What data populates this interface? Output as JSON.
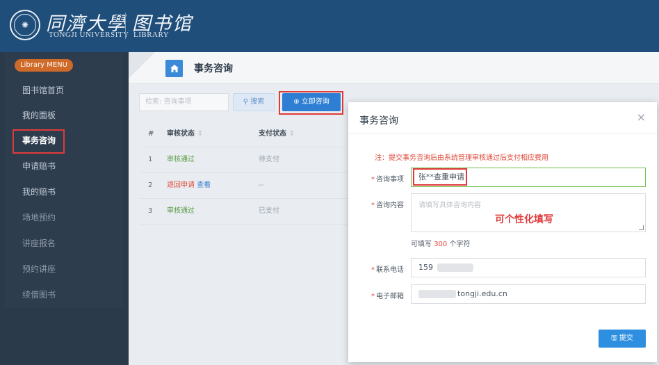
{
  "header": {
    "logo_cn": "同濟大學",
    "logo_en": "TONGJI UNIVERSITY",
    "library_cn": "图书馆",
    "library_en": "LIBRARY"
  },
  "sidebar": {
    "menu_badge": "Library MENU",
    "items": [
      {
        "label": "图书馆首页"
      },
      {
        "label": "我的面板"
      },
      {
        "label": "事务咨询"
      },
      {
        "label": "申请赔书"
      },
      {
        "label": "我的赔书"
      },
      {
        "label": "场地预约"
      },
      {
        "label": "讲座报名"
      },
      {
        "label": "预约讲座"
      },
      {
        "label": "续借图书"
      }
    ],
    "active_index": 2
  },
  "page": {
    "title": "事务咨询",
    "search_placeholder": "检索: 咨询事项",
    "search_label": "搜索",
    "consult_label": "立即咨询"
  },
  "table": {
    "headers": [
      "#",
      "审核状态",
      "支付状态"
    ],
    "rows": [
      {
        "index": "1",
        "status": "审核通过",
        "pay": "待支付"
      },
      {
        "index": "2",
        "status": "退回申请",
        "link": "查看",
        "pay": "--"
      },
      {
        "index": "3",
        "status": "审核通过",
        "pay": "已支付"
      }
    ]
  },
  "modal": {
    "title": "事务咨询",
    "close": "×",
    "notice": "注：提交事务咨询后由系统管理审核通过后支付相应费用",
    "fields": {
      "subject_label": "咨询事项",
      "subject_value": "张**查重申请",
      "content_label": "咨询内容",
      "content_placeholder": "请填写具体咨询内容",
      "content_annotation": "可个性化填写",
      "hint_pre": "可填写",
      "hint_num": "300",
      "hint_post": "个字符",
      "phone_label": "联系电话",
      "phone_value": "159",
      "email_label": "电子邮箱",
      "email_value": "tongji.edu.cn"
    },
    "submit_label": "提交"
  }
}
